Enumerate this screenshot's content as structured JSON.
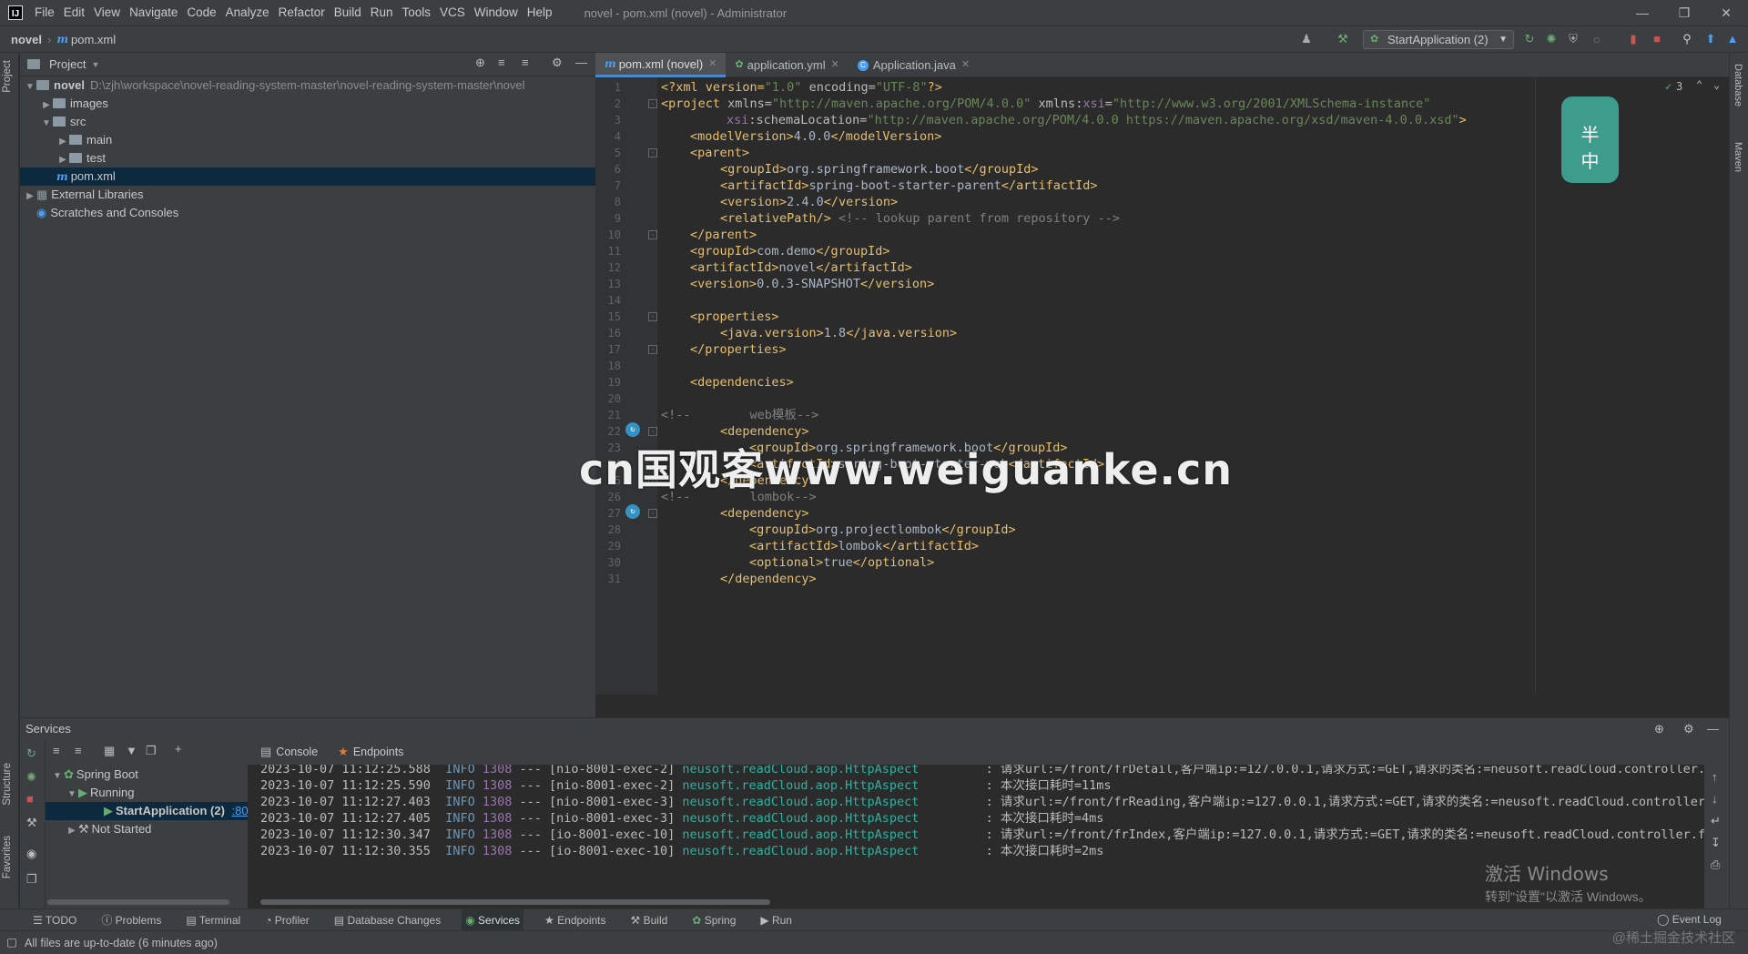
{
  "menubar": {
    "items": [
      "File",
      "Edit",
      "View",
      "Navigate",
      "Code",
      "Analyze",
      "Refactor",
      "Build",
      "Run",
      "Tools",
      "VCS",
      "Window",
      "Help"
    ],
    "window_title": "novel - pom.xml (novel) - Administrator",
    "logo": "IJ"
  },
  "navbar": {
    "project": "novel",
    "file": "pom.xml",
    "run_config": "StartApplication (2)"
  },
  "stripes": {
    "left_top": "Project",
    "left_structure": "Structure",
    "left_favorites": "Favorites",
    "right_database": "Database",
    "right_maven": "Maven"
  },
  "project_panel": {
    "title": "Project",
    "tree": [
      {
        "label": "novel",
        "hint": "D:\\zjh\\workspace\\novel-reading-system-master\\novel-reading-system-master\\novel"
      },
      {
        "label": "images"
      },
      {
        "label": "src"
      },
      {
        "label": "main"
      },
      {
        "label": "test"
      },
      {
        "label": "pom.xml"
      },
      {
        "label": "External Libraries"
      },
      {
        "label": "Scratches and Consoles"
      }
    ]
  },
  "editor_tabs": [
    {
      "label": "pom.xml (novel)"
    },
    {
      "label": "application.yml"
    },
    {
      "label": "Application.java"
    }
  ],
  "editor": {
    "inspection_count": "3",
    "lines": [
      {
        "n": "1"
      },
      {
        "n": "2"
      },
      {
        "n": "3"
      },
      {
        "n": "4"
      },
      {
        "n": "5"
      },
      {
        "n": "6"
      },
      {
        "n": "7"
      },
      {
        "n": "8"
      },
      {
        "n": "9"
      },
      {
        "n": "10"
      },
      {
        "n": "11"
      },
      {
        "n": "12"
      },
      {
        "n": "13"
      },
      {
        "n": "14"
      },
      {
        "n": "15"
      },
      {
        "n": "16"
      },
      {
        "n": "17"
      },
      {
        "n": "18"
      },
      {
        "n": "19"
      },
      {
        "n": "20"
      },
      {
        "n": "21"
      },
      {
        "n": "22"
      },
      {
        "n": "23"
      },
      {
        "n": "24"
      },
      {
        "n": "25"
      },
      {
        "n": "26"
      },
      {
        "n": "27"
      },
      {
        "n": "28"
      },
      {
        "n": "29"
      },
      {
        "n": "30"
      },
      {
        "n": "31"
      }
    ],
    "code": {
      "l1a": "<?xml version=",
      "l1b": "\"1.0\"",
      "l1c": " encoding=",
      "l1d": "\"UTF-8\"",
      "l1e": "?>",
      "l2a": "<project ",
      "l2b": "xmlns=",
      "l2c": "\"http://maven.apache.org/POM/4.0.0\"",
      "l2d": " xmlns:",
      "l2e": "xsi",
      "l2f": "=",
      "l2g": "\"http://www.w3.org/2001/XMLSchema-instance\"",
      "l3a": "xsi",
      "l3b": ":schemaLocation=",
      "l3c": "\"http://maven.apache.org/POM/4.0.0 https://maven.apache.org/xsd/maven-4.0.0.xsd\"",
      "l3d": ">",
      "l4a": "<modelVersion>",
      "l4b": "4.0.0",
      "l4c": "</modelVersion>",
      "l5": "<parent>",
      "l6a": "<groupId>",
      "l6b": "org.springframework.boot",
      "l6c": "</groupId>",
      "l7a": "<artifactId>",
      "l7b": "spring-boot-starter-parent",
      "l7c": "</artifactId>",
      "l8a": "<version>",
      "l8b": "2.4.0",
      "l8c": "</version>",
      "l9a": "<relativePath/>",
      "l9b": " <!-- lookup parent from repository -->",
      "l10": "</parent>",
      "l11a": "<groupId>",
      "l11b": "com.demo",
      "l11c": "</groupId>",
      "l12a": "<artifactId>",
      "l12b": "novel",
      "l12c": "</artifactId>",
      "l13a": "<version>",
      "l13b": "0.0.3-SNAPSHOT",
      "l13c": "</version>",
      "l15": "<properties>",
      "l16a": "<java.version>",
      "l16b": "1.8",
      "l16c": "</java.version>",
      "l17": "</properties>",
      "l19": "<dependencies>",
      "l21": "<!--        web模板-->",
      "l22": "<dependency>",
      "l23a": "<groupId>",
      "l23b": "org.springframework.boot",
      "l23c": "</groupId>",
      "l24a": "<artifactId>",
      "l24b": "spring-boot-starter-web",
      "l24c": "</artifactId>",
      "l25": "</dependency>",
      "l26": "<!--        lombok-->",
      "l27": "<dependency>",
      "l28a": "<groupId>",
      "l28b": "org.projectlombok",
      "l28c": "</groupId>",
      "l29a": "<artifactId>",
      "l29b": "lombok",
      "l29c": "</artifactId>",
      "l30a": "<optional>",
      "l30b": "true",
      "l30c": "</optional>",
      "l31": "</dependency>"
    }
  },
  "watermark": "cn国观客www.weiguanke.cn",
  "sticker": {
    "line1": "半",
    "line2": "中"
  },
  "services": {
    "title": "Services",
    "tree": {
      "spring_boot": "Spring Boot",
      "running": "Running",
      "app": "StartApplication (2)",
      "port": ":80",
      "not_started": "Not Started"
    },
    "console_tabs": [
      "Console",
      "Endpoints"
    ],
    "logs": [
      {
        "ts": "2023-10-07 11:12:25.588",
        "lvl": "INFO",
        "pid": "1308",
        "thread": "--- [nio-8001-exec-2]",
        "cls": "neusoft.readCloud.aop.HttpAspect",
        "msg": ": 请求url:=/front/frDetail,客户端ip:=127.0.0.1,请求方式:=GET,请求的类名:=neusoft.readCloud.controller.fron"
      },
      {
        "ts": "2023-10-07 11:12:25.590",
        "lvl": "INFO",
        "pid": "1308",
        "thread": "--- [nio-8001-exec-2]",
        "cls": "neusoft.readCloud.aop.HttpAspect",
        "msg": ": 本次接口耗时=11ms"
      },
      {
        "ts": "2023-10-07 11:12:27.403",
        "lvl": "INFO",
        "pid": "1308",
        "thread": "--- [nio-8001-exec-3]",
        "cls": "neusoft.readCloud.aop.HttpAspect",
        "msg": ": 请求url:=/front/frReading,客户端ip:=127.0.0.1,请求方式:=GET,请求的类名:=neusoft.readCloud.controller.fro"
      },
      {
        "ts": "2023-10-07 11:12:27.405",
        "lvl": "INFO",
        "pid": "1308",
        "thread": "--- [nio-8001-exec-3]",
        "cls": "neusoft.readCloud.aop.HttpAspect",
        "msg": ": 本次接口耗时=4ms"
      },
      {
        "ts": "2023-10-07 11:12:30.347",
        "lvl": "INFO",
        "pid": "1308",
        "thread": "--- [io-8001-exec-10]",
        "cls": "neusoft.readCloud.aop.HttpAspect",
        "msg": ": 请求url:=/front/frIndex,客户端ip:=127.0.0.1,请求方式:=GET,请求的类名:=neusoft.readCloud.controller.front"
      },
      {
        "ts": "2023-10-07 11:12:30.355",
        "lvl": "INFO",
        "pid": "1308",
        "thread": "--- [io-8001-exec-10]",
        "cls": "neusoft.readCloud.aop.HttpAspect",
        "msg": ": 本次接口耗时=2ms"
      }
    ],
    "activate_title": "激活 Windows",
    "activate_sub": "转到\"设置\"以激活 Windows。"
  },
  "toolwindow_tabs": [
    "TODO",
    "Problems",
    "Terminal",
    "Profiler",
    "Database Changes",
    "Services",
    "Endpoints",
    "Build",
    "Spring",
    "Run"
  ],
  "event_log": "Event Log",
  "status": "All files are up-to-date (6 minutes ago)",
  "corner_mark": "@稀土掘金技术社区",
  "colors": {
    "tag": "#e8bf6a",
    "string": "#6a8759",
    "comment": "#808080",
    "selection": "#0d293e",
    "accent": "#4a88c7"
  }
}
